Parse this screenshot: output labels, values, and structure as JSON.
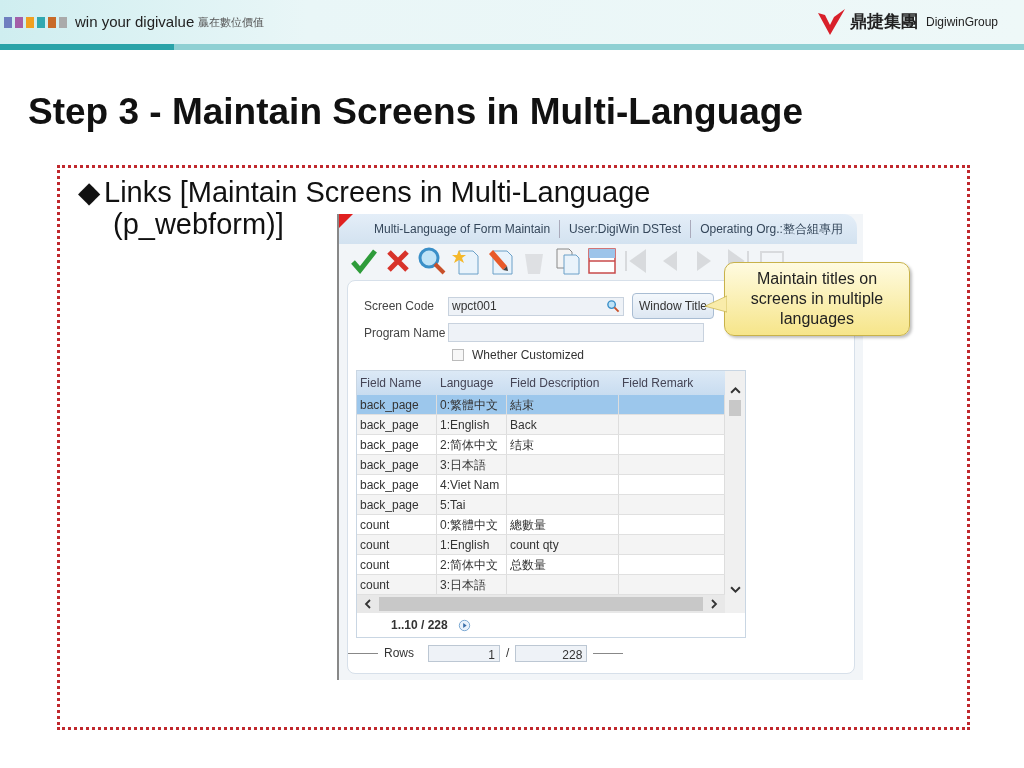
{
  "header": {
    "tagline": "win your digivalue",
    "tagline_cn": "贏在數位價值",
    "logo_cn": "鼎捷集團",
    "logo_en": "DigiwinGroup"
  },
  "title": "Step 3 - Maintain Screens in Multi-Language",
  "bullet": {
    "marker": "◆",
    "line_1": "Links [Maintain Screens in Multi-Language",
    "line_2": "(p_webform)]"
  },
  "window": {
    "tabs": [
      "Multi-Language of Form Maintain",
      "User:DigiWin DSTest",
      "Operating Org.:整合組專用"
    ],
    "toolbar": [
      {
        "kind": "confirm",
        "disabled": false
      },
      {
        "kind": "cancel",
        "disabled": false
      },
      {
        "kind": "search",
        "disabled": false
      },
      {
        "kind": "new",
        "disabled": false
      },
      {
        "kind": "edit",
        "disabled": false
      },
      {
        "kind": "delete",
        "disabled": true
      },
      {
        "kind": "copy",
        "disabled": false
      },
      {
        "kind": "layout",
        "disabled": false
      },
      {
        "kind": "first",
        "disabled": true
      },
      {
        "kind": "prev",
        "disabled": true
      },
      {
        "kind": "next",
        "disabled": true
      },
      {
        "kind": "last",
        "disabled": true
      },
      {
        "kind": "view",
        "disabled": true
      }
    ],
    "screen_code": {
      "label": "Screen Code",
      "value": "wpct001"
    },
    "window_title_button": "Window Title",
    "program_name": {
      "label": "Program Name"
    },
    "customized": {
      "label": "Whether Customized",
      "checked": false
    },
    "table": {
      "columns": [
        "Field Name",
        "Language",
        "Field Description",
        "Field Remark"
      ],
      "rows": [
        {
          "cells": [
            "back_page",
            "0:繁體中文",
            "結束",
            ""
          ],
          "selected": true
        },
        {
          "cells": [
            "back_page",
            "1:English",
            "Back",
            ""
          ],
          "selected": false
        },
        {
          "cells": [
            "back_page",
            "2:简体中文",
            "结束",
            ""
          ],
          "selected": false
        },
        {
          "cells": [
            "back_page",
            "3:日本語",
            "",
            ""
          ],
          "selected": false
        },
        {
          "cells": [
            "back_page",
            "4:Viet Nam",
            "",
            ""
          ],
          "selected": false
        },
        {
          "cells": [
            "back_page",
            "5:Tai",
            "",
            ""
          ],
          "selected": false
        },
        {
          "cells": [
            "count",
            "0:繁體中文",
            "總數量",
            ""
          ],
          "selected": false
        },
        {
          "cells": [
            "count",
            "1:English",
            "count qty",
            ""
          ],
          "selected": false
        },
        {
          "cells": [
            "count",
            "2:简体中文",
            "总数量",
            ""
          ],
          "selected": false
        },
        {
          "cells": [
            "count",
            "3:日本語",
            "",
            ""
          ],
          "selected": false
        }
      ]
    },
    "pager": "1..10 / 228",
    "rows_footer": {
      "label": "Rows",
      "current": "1",
      "separator": "/",
      "total": "228"
    }
  },
  "callout": "Maintain titles on screens in multiple languages"
}
